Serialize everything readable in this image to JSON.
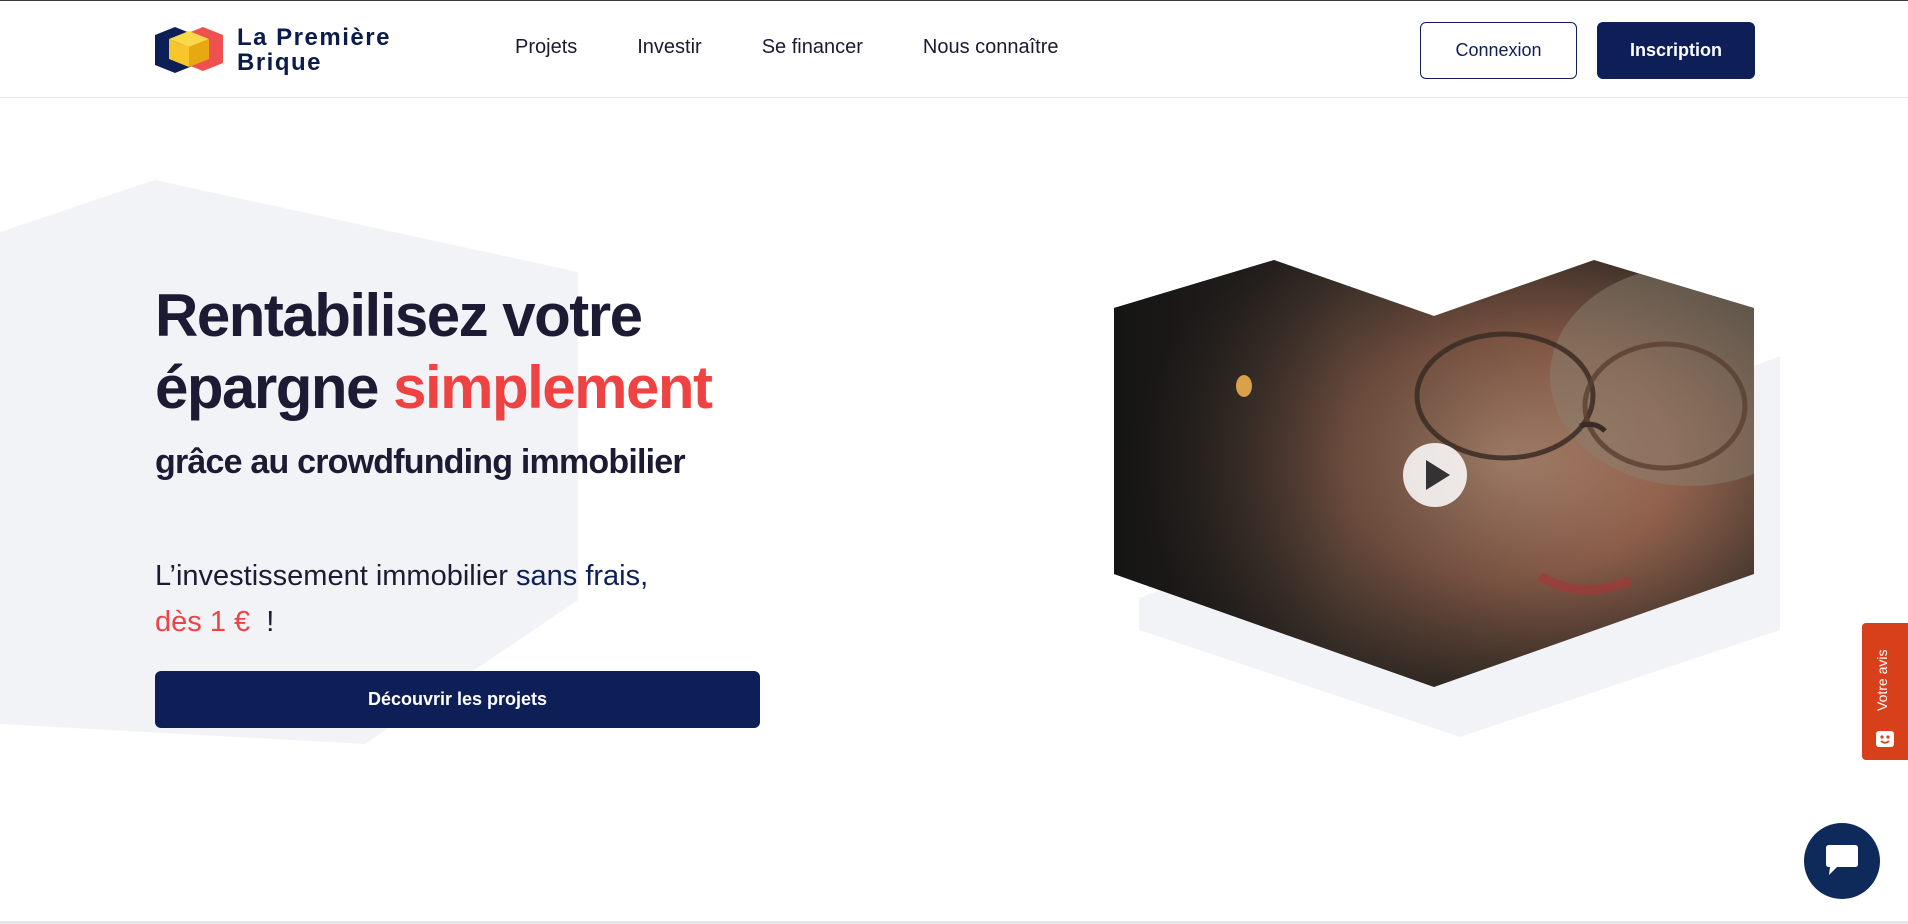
{
  "brand": {
    "name_line1": "La Première",
    "name_line2": "Brique",
    "colors": {
      "navy": "#0e1f57",
      "red": "#ef4343",
      "yellow": "#f7c52c"
    }
  },
  "nav": {
    "items": [
      {
        "label": "Projets"
      },
      {
        "label": "Investir"
      },
      {
        "label": "Se financer"
      },
      {
        "label": "Nous connaître"
      }
    ]
  },
  "header": {
    "login_label": "Connexion",
    "signup_label": "Inscription"
  },
  "hero": {
    "headline_part1": "Rentabilisez votre",
    "headline_part2": "épargne ",
    "headline_accent": "simplement",
    "subheadline": "grâce au crowdfunding immobilier",
    "tagline_part1": "L’investissement immobilier ",
    "tagline_part2": "sans frais,",
    "tagline_price": "dès 1 €",
    "tagline_end": "!",
    "cta_label": "Découvrir les projets"
  },
  "video": {
    "play_icon": "play-icon"
  },
  "feedback": {
    "label": "Votre avis",
    "icon": "smiley-icon"
  },
  "chat": {
    "icon": "chat-icon"
  }
}
